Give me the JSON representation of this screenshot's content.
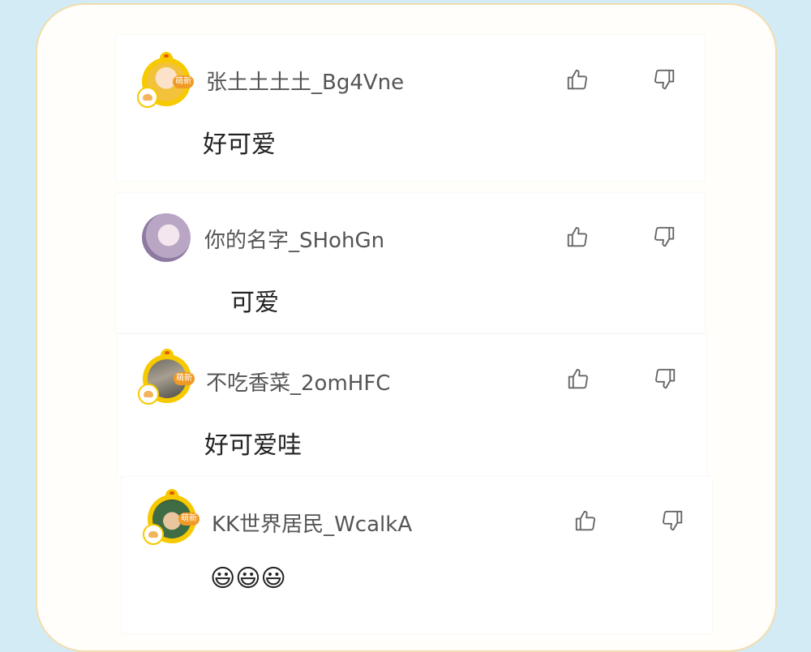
{
  "comments": [
    {
      "username": "张土土土土_Bg4Vne",
      "text": "好可爱",
      "badge": "萌新",
      "avatar": "avatar-frame-yellow-girl"
    },
    {
      "username": "你的名字_SHohGn",
      "text": "可爱",
      "avatar": "avatar-plain-girl"
    },
    {
      "username": "不吃香菜_2omHFC",
      "text": "好可爱哇",
      "badge": "萌新",
      "avatar": "avatar-frame-yellow-photo"
    },
    {
      "username": "KK世界居民_WcalkA",
      "text": "😃😃😃",
      "badge": "萌新",
      "avatar": "avatar-frame-yellow-anime"
    }
  ],
  "icons": {
    "like": "thumbs-up-icon",
    "dislike": "thumbs-down-icon"
  },
  "colors": {
    "background": "#d3ebf5",
    "card_border": "#f3dcae",
    "avatar_frame": "#f6c900",
    "badge": "#f09a26"
  }
}
